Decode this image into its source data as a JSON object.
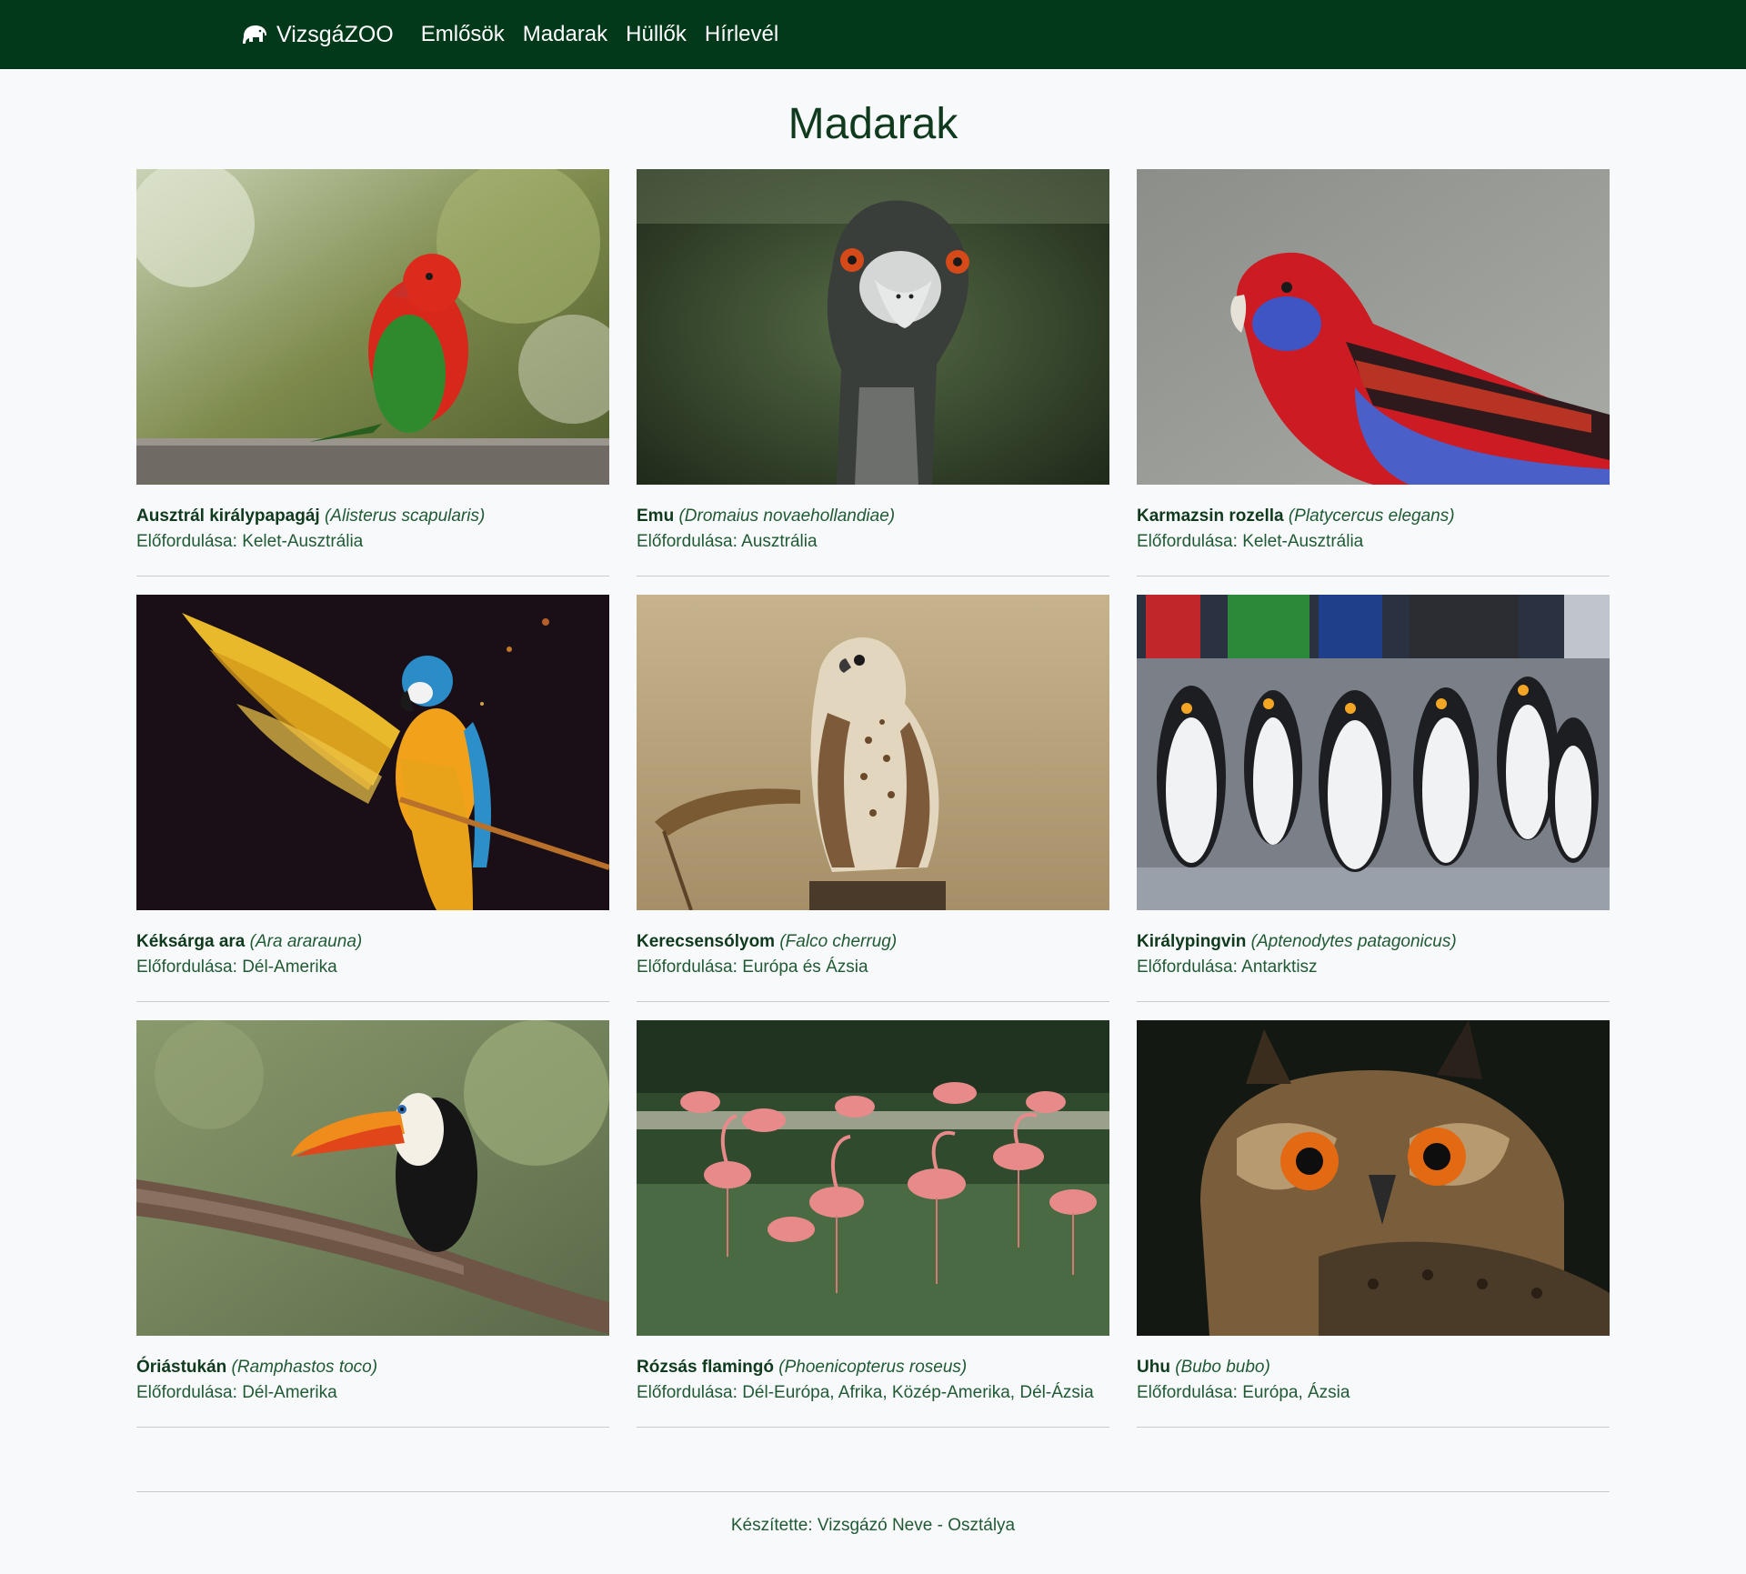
{
  "navbar": {
    "brand": "VizsgáZOO",
    "links": [
      "Emlősök",
      "Madarak",
      "Hüllők",
      "Hírlevél"
    ]
  },
  "page": {
    "title": "Madarak"
  },
  "birds": [
    {
      "name": "Ausztrál királypapagáj",
      "latin": "(Alisterus scapularis)",
      "occ_label": "Előfordulása:",
      "occ": "Kelet-Ausztrália"
    },
    {
      "name": "Emu",
      "latin": "(Dromaius novaehollandiae)",
      "occ_label": "Előfordulása:",
      "occ": "Ausztrália"
    },
    {
      "name": "Karmazsin rozella",
      "latin": "(Platycercus elegans)",
      "occ_label": "Előfordulása:",
      "occ": "Kelet-Ausztrália"
    },
    {
      "name": "Kéksárga ara",
      "latin": "(Ara ararauna)",
      "occ_label": "Előfordulása:",
      "occ": "Dél-Amerika"
    },
    {
      "name": "Kerecsensólyom",
      "latin": "(Falco cherrug)",
      "occ_label": "Előfordulása:",
      "occ": "Európa és Ázsia"
    },
    {
      "name": "Királypingvin",
      "latin": "(Aptenodytes patagonicus)",
      "occ_label": "Előfordulása:",
      "occ": "Antarktisz"
    },
    {
      "name": "Óriástukán",
      "latin": "(Ramphastos toco)",
      "occ_label": "Előfordulása:",
      "occ": "Dél-Amerika"
    },
    {
      "name": "Rózsás flamingó",
      "latin": "(Phoenicopterus roseus)",
      "occ_label": "Előfordulása:",
      "occ": "Dél-Európa, Afrika, Közép-Amerika, Dél-Ázsia"
    },
    {
      "name": "Uhu",
      "latin": "(Bubo bubo)",
      "occ_label": "Előfordulása:",
      "occ": "Európa, Ázsia"
    }
  ],
  "footer": {
    "text": "Készítette: Vizsgázó Neve - Osztálya"
  },
  "colors": {
    "navbar_bg": "#01391a",
    "page_bg": "#f8f9fa",
    "text_dark": "#0f3a1d",
    "text_green": "#1f5a34",
    "divider": "#c5ccd2"
  }
}
